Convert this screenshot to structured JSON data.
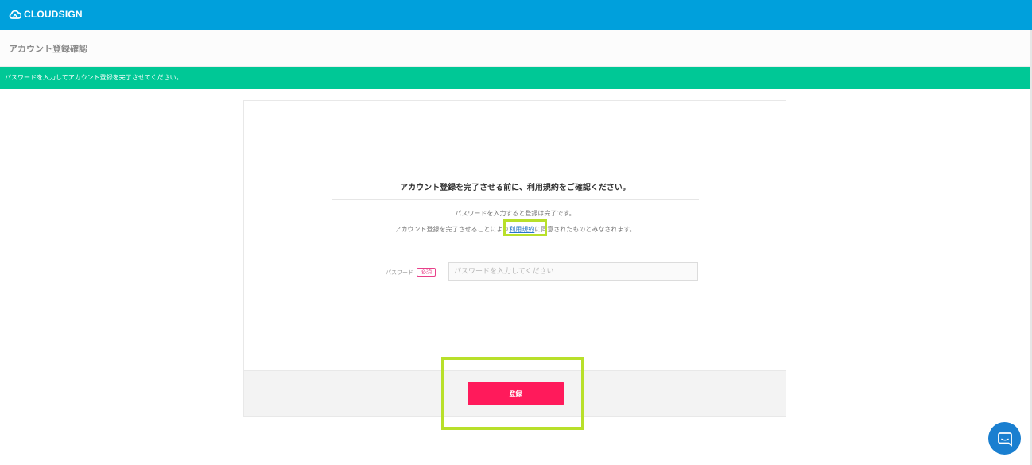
{
  "header": {
    "brand": "CLOUDSIGN",
    "brand_color": "#00a0dc"
  },
  "subheader": {
    "title": "アカウント登録確認"
  },
  "notice": {
    "message": "パスワードを入力してアカウント登録を完了させてください。",
    "color": "#00c896"
  },
  "form": {
    "heading": "アカウント登録を完了させる前に、利用規約をご確認ください。",
    "line1": "パスワードを入力すると登録は完了です。",
    "line2_prefix": "アカウント登録を完了させることにより",
    "terms_link": "利用規約",
    "line2_suffix": "に同意されたものとみなされます。",
    "password_label": "パスワード",
    "required_badge": "必須",
    "password_placeholder": "パスワードを入力してください",
    "password_value": "",
    "submit_label": "登録",
    "submit_color": "#ff1a5b"
  },
  "chat": {
    "icon": "chat-icon"
  },
  "highlight_color": "#b8e02a"
}
